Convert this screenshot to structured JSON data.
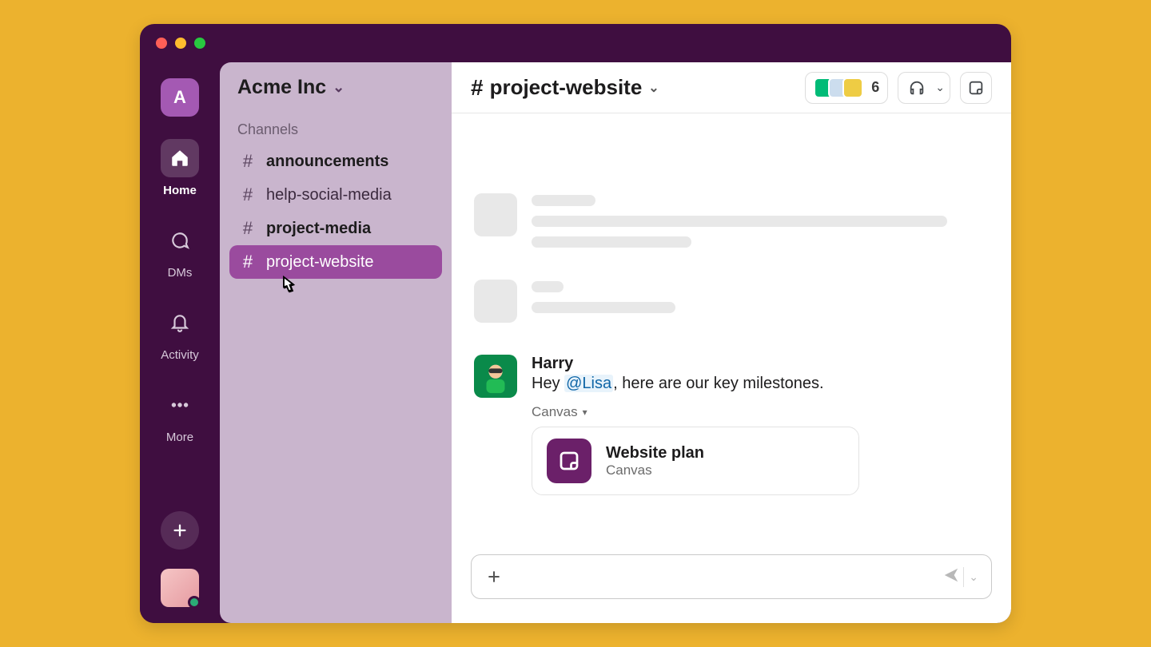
{
  "rail": {
    "workspace_initial": "A",
    "items": [
      {
        "label": "Home"
      },
      {
        "label": "DMs"
      },
      {
        "label": "Activity"
      },
      {
        "label": "More"
      }
    ]
  },
  "sidebar": {
    "workspace_name": "Acme Inc",
    "section_label": "Channels",
    "channels": [
      {
        "name": "announcements"
      },
      {
        "name": "help-social-media"
      },
      {
        "name": "project-media"
      },
      {
        "name": "project-website"
      }
    ]
  },
  "channel": {
    "name": "project-website",
    "member_count": "6"
  },
  "message": {
    "user": "Harry",
    "text_prefix": "Hey ",
    "mention": "@Lisa",
    "text_suffix": ", here are our key milestones.",
    "attachment_label": "Canvas",
    "canvas": {
      "title": "Website plan",
      "subtitle": "Canvas"
    }
  },
  "composer": {
    "placeholder": ""
  }
}
